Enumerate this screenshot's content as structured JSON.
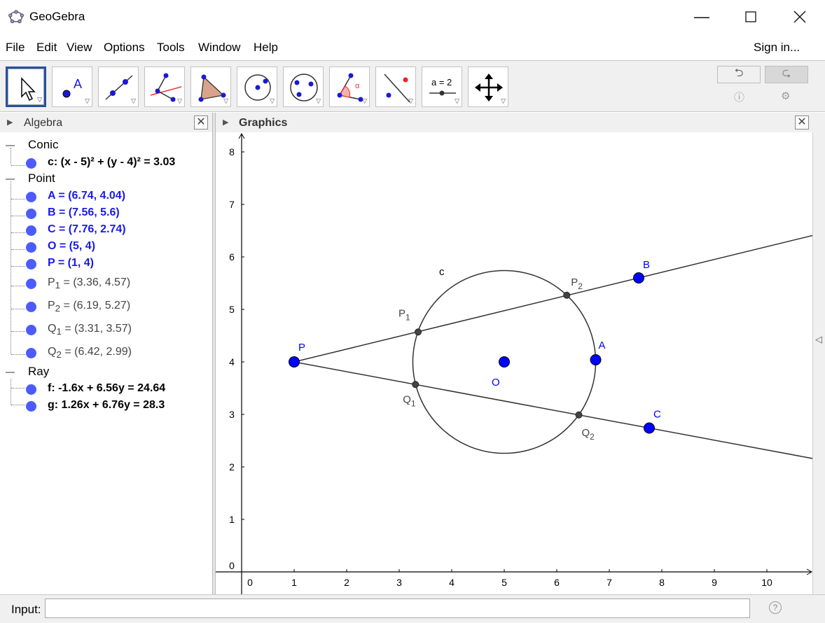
{
  "window": {
    "title": "GeoGebra",
    "minimize_icon": "minimize-icon",
    "maximize_icon": "maximize-icon",
    "close_icon": "close-icon"
  },
  "menu": {
    "items": [
      "File",
      "Edit",
      "View",
      "Options",
      "Tools",
      "Window",
      "Help"
    ],
    "sign_in": "Sign in..."
  },
  "toolbar": {
    "tools": [
      "move-tool-icon",
      "point-tool-icon",
      "line-tool-icon",
      "perpendicular-line-tool-icon",
      "polygon-tool-icon",
      "circle-center-point-tool-icon",
      "circle-three-points-tool-icon",
      "angle-tool-icon",
      "reflect-tool-icon",
      "slider-tool-icon",
      "move-graphics-view-tool-icon"
    ],
    "slider_label": "a = 2",
    "angle_symbol": "α",
    "point_label": "A",
    "undo_icon": "undo-icon",
    "redo_icon": "redo-icon",
    "help_icon": "help-icon",
    "settings_icon": "gear-icon"
  },
  "algebra": {
    "title": "Algebra",
    "groups": [
      {
        "name": "Conic",
        "items": [
          {
            "text": "c: (x - 5)² + (y - 4)² = 3.03",
            "style": "bold-black"
          }
        ]
      },
      {
        "name": "Point",
        "items": [
          {
            "text": "A = (6.74, 4.04)",
            "style": "bold-blue"
          },
          {
            "text": "B = (7.56, 5.6)",
            "style": "bold-blue"
          },
          {
            "text": "C = (7.76, 2.74)",
            "style": "bold-blue"
          },
          {
            "text": "O = (5, 4)",
            "style": "bold-blue"
          },
          {
            "text": "P = (1, 4)",
            "style": "bold-blue"
          },
          {
            "name": "P",
            "sub": "1",
            "value": " = (3.36, 4.57)",
            "style": "plain"
          },
          {
            "name": "P",
            "sub": "2",
            "value": " = (6.19, 5.27)",
            "style": "plain"
          },
          {
            "name": "Q",
            "sub": "1",
            "value": " = (3.31, 3.57)",
            "style": "plain"
          },
          {
            "name": "Q",
            "sub": "2",
            "value": " = (6.42, 2.99)",
            "style": "plain"
          }
        ]
      },
      {
        "name": "Ray",
        "items": [
          {
            "text": "f: -1.6x + 6.56y = 24.64",
            "style": "bold-black"
          },
          {
            "text": "g: 1.26x + 6.76y = 28.3",
            "style": "bold-black"
          }
        ]
      }
    ],
    "colors": {
      "free_point": "#0000ff",
      "dependent_point": "#444444",
      "dot": "#4b5bff"
    }
  },
  "graphics": {
    "title": "Graphics",
    "x_ticks": [
      "0",
      "1",
      "2",
      "3",
      "4",
      "5",
      "6",
      "7",
      "8",
      "9",
      "10"
    ],
    "y_ticks": [
      "0",
      "1",
      "2",
      "3",
      "4",
      "5",
      "6",
      "7",
      "8"
    ],
    "circle": {
      "label": "c",
      "center": [
        5,
        4
      ],
      "radius_squared": 3.03
    },
    "free_points": [
      {
        "name": "A",
        "x": 6.74,
        "y": 4.04
      },
      {
        "name": "B",
        "x": 7.56,
        "y": 5.6
      },
      {
        "name": "C",
        "x": 7.76,
        "y": 2.74
      },
      {
        "name": "O",
        "x": 5,
        "y": 4
      },
      {
        "name": "P",
        "x": 1,
        "y": 4
      }
    ],
    "dependent_points": [
      {
        "name": "P",
        "sub": "1",
        "x": 3.36,
        "y": 4.57
      },
      {
        "name": "P",
        "sub": "2",
        "x": 6.19,
        "y": 5.27
      },
      {
        "name": "Q",
        "sub": "1",
        "x": 3.31,
        "y": 3.57
      },
      {
        "name": "Q",
        "sub": "2",
        "x": 6.42,
        "y": 2.99
      }
    ],
    "rays": [
      {
        "name": "f",
        "from": "P",
        "through": "B"
      },
      {
        "name": "g",
        "from": "P",
        "through": "C"
      }
    ],
    "colors": {
      "free_point": "#0000ff",
      "dependent_point": "#444444",
      "line": "#333333",
      "free_label": "#0000ff",
      "dependent_label": "#444444"
    }
  },
  "input_bar": {
    "label": "Input:",
    "value": "",
    "help_icon": "help-icon"
  }
}
